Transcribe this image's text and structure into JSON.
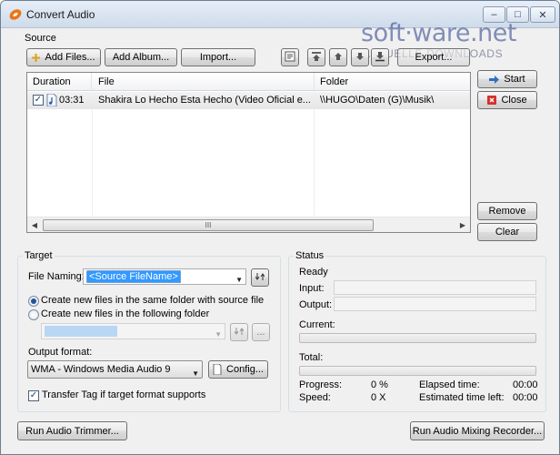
{
  "window": {
    "title": "Convert Audio",
    "buttons": {
      "minimize": "–",
      "maximize": "□",
      "close": "✕"
    }
  },
  "watermark": {
    "brand": "soft·ware.net",
    "subtitle": "AKTUELLE DOWNLOADS"
  },
  "source": {
    "label": "Source",
    "toolbar": {
      "add_files": "Add Files...",
      "add_album": "Add Album...",
      "import": "Import...",
      "export": "Export..."
    },
    "columns": [
      "Duration",
      "File",
      "Folder"
    ],
    "rows": [
      {
        "checked": true,
        "duration": "03:31",
        "file": "Shakira Lo Hecho Esta Hecho (Video Oficial e...",
        "folder": "\\\\HUGO\\Daten (G)\\Musik\\"
      }
    ],
    "scroll_thumb": "III",
    "side_buttons": {
      "start": "Start",
      "close": "Close",
      "remove": "Remove",
      "clear": "Clear"
    }
  },
  "target": {
    "label": "Target",
    "file_naming_label": "File Naming:",
    "file_naming_value": "<Source FileName>",
    "radio_same": "Create new files in the same folder with source file",
    "radio_other": "Create new files in the following folder",
    "radio_selected": "same",
    "folder_value": "",
    "folder_browse": "...",
    "output_format_label": "Output format:",
    "output_format_value": "WMA - Windows Media Audio 9",
    "config_button": "Config...",
    "transfer_tag_label": "Transfer Tag if target format supports",
    "transfer_tag_checked": true
  },
  "status": {
    "label": "Status",
    "state": "Ready",
    "input_label": "Input:",
    "output_label": "Output:",
    "current_label": "Current:",
    "current_progress": 0,
    "total_label": "Total:",
    "total_progress": 0,
    "progress_label": "Progress:",
    "progress_value": "0 %",
    "speed_label": "Speed:",
    "speed_value": "0 X",
    "elapsed_label": "Elapsed time:",
    "elapsed_value": "00:00",
    "estimated_label": "Estimated time left:",
    "estimated_value": "00:00"
  },
  "footer": {
    "trimmer_button": "Run Audio Trimmer...",
    "mixing_button": "Run Audio Mixing Recorder..."
  },
  "colors": {
    "accent_blue": "#3399ff",
    "close_red": "#d6302b",
    "progress_green": "#3cb043"
  }
}
